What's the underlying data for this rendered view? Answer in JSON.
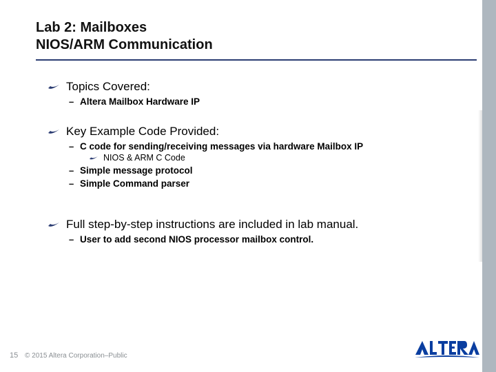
{
  "title": {
    "line1": "Lab 2: Mailboxes",
    "line2": "NIOS/ARM Communication"
  },
  "sections": {
    "s1": {
      "heading": "Topics Covered:",
      "items": {
        "i1": "Altera Mailbox Hardware IP"
      }
    },
    "s2": {
      "heading": "Key Example Code Provided:",
      "items": {
        "i1": "C code for sending/receiving messages via hardware Mailbox IP",
        "i1_sub": {
          "a": "NIOS & ARM C Code"
        },
        "i2": "Simple message protocol",
        "i3": "Simple Command parser"
      }
    },
    "s3": {
      "heading": "Full step-by-step instructions are included in lab manual.",
      "items": {
        "i1": "User to add second NIOS processor mailbox control."
      }
    }
  },
  "footer": {
    "page": "15",
    "copyright": "© 2015 Altera Corporation–Public",
    "logo_text": "ALTERA"
  },
  "colors": {
    "rule": "#2b3c72",
    "rail": "#aeb7bf",
    "bullet": "#2b3c72"
  }
}
